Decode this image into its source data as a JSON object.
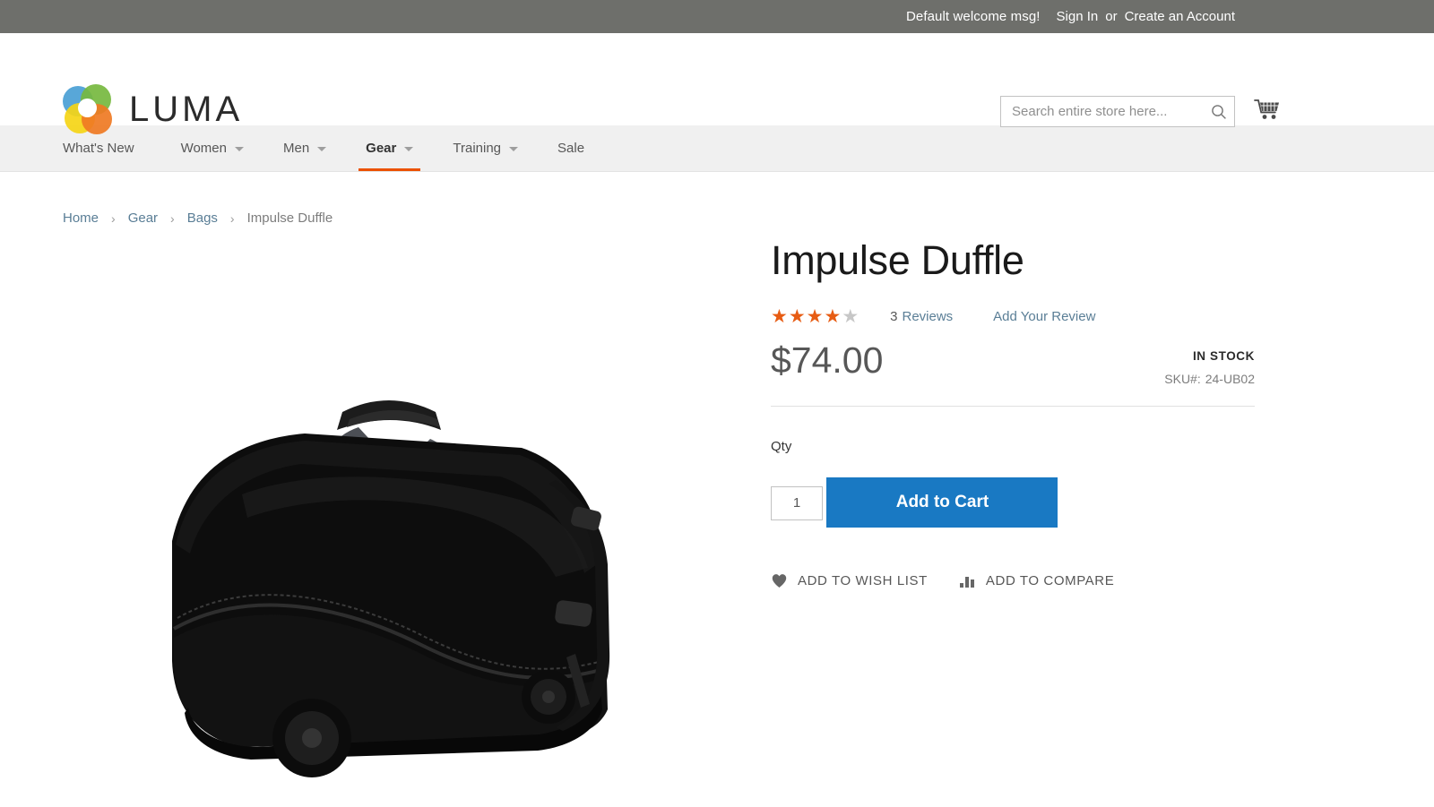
{
  "top_panel": {
    "welcome": "Default welcome msg!",
    "sign_in": "Sign In",
    "or": "or",
    "create_account": "Create an Account"
  },
  "header": {
    "logo_text": "LUMA",
    "logo_icon": "luma-flower-logo",
    "colors": {
      "logo_blue": "#4aa0d5",
      "logo_green": "#76b83f",
      "logo_yellow": "#f5d516",
      "logo_orange": "#ef7923"
    },
    "search": {
      "placeholder": "Search entire store here...",
      "value": "",
      "icon": "search-icon"
    },
    "cart_icon": "shopping-cart-icon"
  },
  "nav": {
    "items": [
      {
        "label": "What's New",
        "has_caret": false,
        "active": false
      },
      {
        "label": "Women",
        "has_caret": true,
        "active": false
      },
      {
        "label": "Men",
        "has_caret": true,
        "active": false
      },
      {
        "label": "Gear",
        "has_caret": true,
        "active": true
      },
      {
        "label": "Training",
        "has_caret": true,
        "active": false
      },
      {
        "label": "Sale",
        "has_caret": false,
        "active": false
      }
    ],
    "active_underline_color": "#eb5202"
  },
  "breadcrumb": {
    "items": [
      "Home",
      "Gear",
      "Bags"
    ],
    "current": "Impulse Duffle",
    "separator": "›"
  },
  "product": {
    "title": "Impulse Duffle",
    "image_alt": "black-rolling-duffle-bag",
    "rating": {
      "filled": 4,
      "total": 5,
      "star_glyph": "★",
      "filled_color": "#e75c13",
      "empty_color": "#c7c7c7"
    },
    "reviews_count": "3",
    "reviews_label": "Reviews",
    "add_review_label": "Add Your Review",
    "price": "$74.00",
    "stock_status": "IN STOCK",
    "sku_label": "SKU#:",
    "sku_value": "24-UB02",
    "qty_label": "Qty",
    "qty_value": "1",
    "add_to_cart_label": "Add to Cart",
    "add_to_cart_color": "#1979c3",
    "wish_list_label": "ADD TO WISH LIST",
    "wish_list_icon": "heart-icon",
    "compare_label": "ADD TO COMPARE",
    "compare_icon": "bar-chart-icon"
  }
}
